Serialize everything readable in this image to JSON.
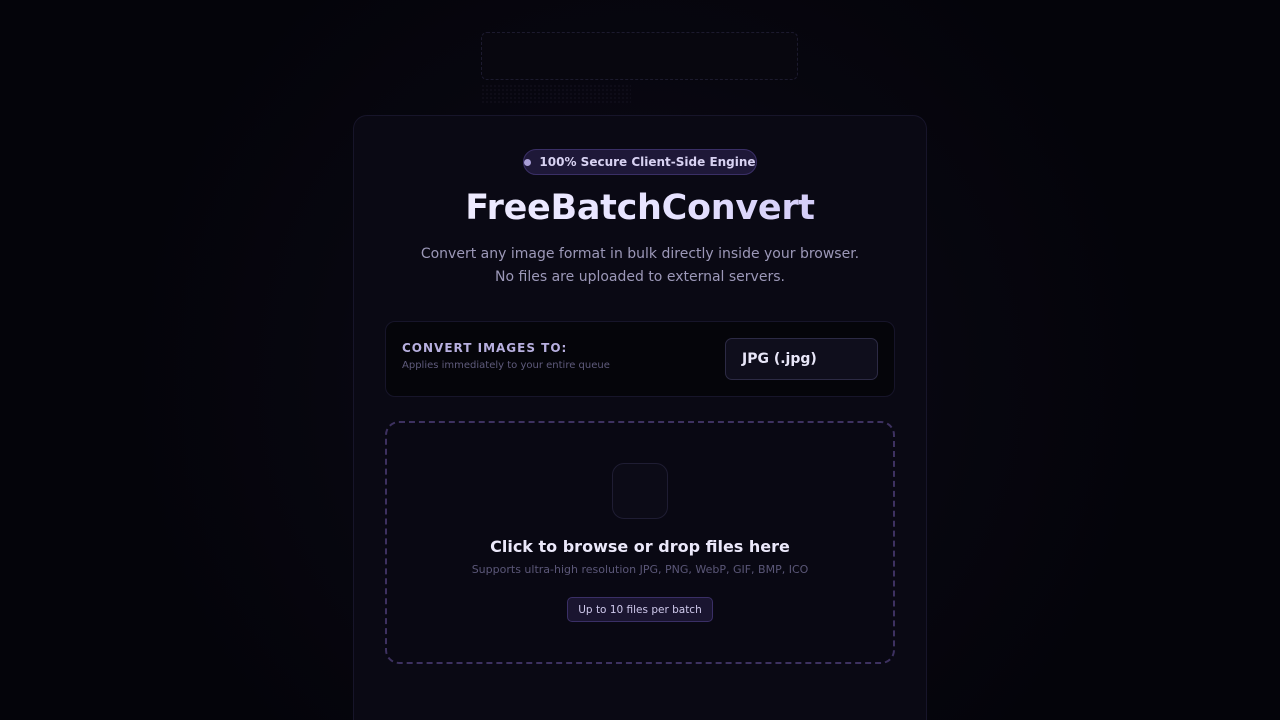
{
  "hero": {
    "badge": "100% Secure Client-Side Engine",
    "title": "FreeBatchConvert",
    "subtitle": "Convert any image format in bulk directly inside your browser. No files are uploaded to external servers."
  },
  "format": {
    "label": "CONVERT IMAGES TO:",
    "hint": "Applies immediately to your entire queue",
    "selected": "JPG (.jpg)"
  },
  "dropzone": {
    "title": "Click to browse or drop files here",
    "formats": "Supports ultra-high resolution JPG, PNG, WebP, GIF, BMP, ICO",
    "limit": "Up to 10 files per batch"
  },
  "colors": {
    "background": "#05050c",
    "card": "#0a0914",
    "accent": "#3a2f66",
    "badge_dot": "#a89ed6"
  },
  "icons": {
    "upload": "upload-icon",
    "badge": "status-dot-icon"
  }
}
